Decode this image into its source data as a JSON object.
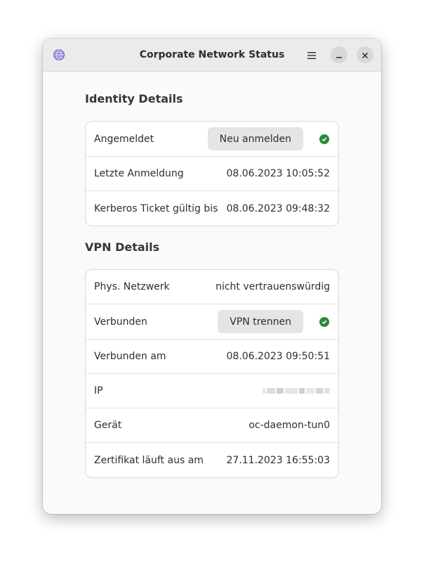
{
  "window": {
    "title": "Corporate Network Status"
  },
  "identity": {
    "heading": "Identity Details",
    "rows": [
      {
        "label": "Angemeldet",
        "button": "Neu anmelden",
        "status": "ok"
      },
      {
        "label": "Letzte Anmeldung",
        "value": "08.06.2023 10:05:52"
      },
      {
        "label": "Kerberos Ticket gültig bis",
        "value": "08.06.2023 09:48:32"
      }
    ]
  },
  "vpn": {
    "heading": "VPN Details",
    "rows": [
      {
        "label": "Phys. Netzwerk",
        "value": "nicht vertrauenswürdig"
      },
      {
        "label": "Verbunden",
        "button": "VPN trennen",
        "status": "ok"
      },
      {
        "label": "Verbunden am",
        "value": "08.06.2023 09:50:51"
      },
      {
        "label": "IP",
        "value": ""
      },
      {
        "label": "Gerät",
        "value": "oc-daemon-tun0"
      },
      {
        "label": "Zertifikat läuft aus am",
        "value": "27.11.2023 16:55:03"
      }
    ]
  },
  "colors": {
    "status_ok": "#2b8a3e",
    "window_bg": "#fafafa",
    "titlebar_bg": "#ebebeb"
  },
  "icons": {
    "app": "globe-icon",
    "menu": "hamburger-menu-icon",
    "minimize": "minimize-icon",
    "close": "close-icon",
    "status": "check-circle-icon"
  }
}
